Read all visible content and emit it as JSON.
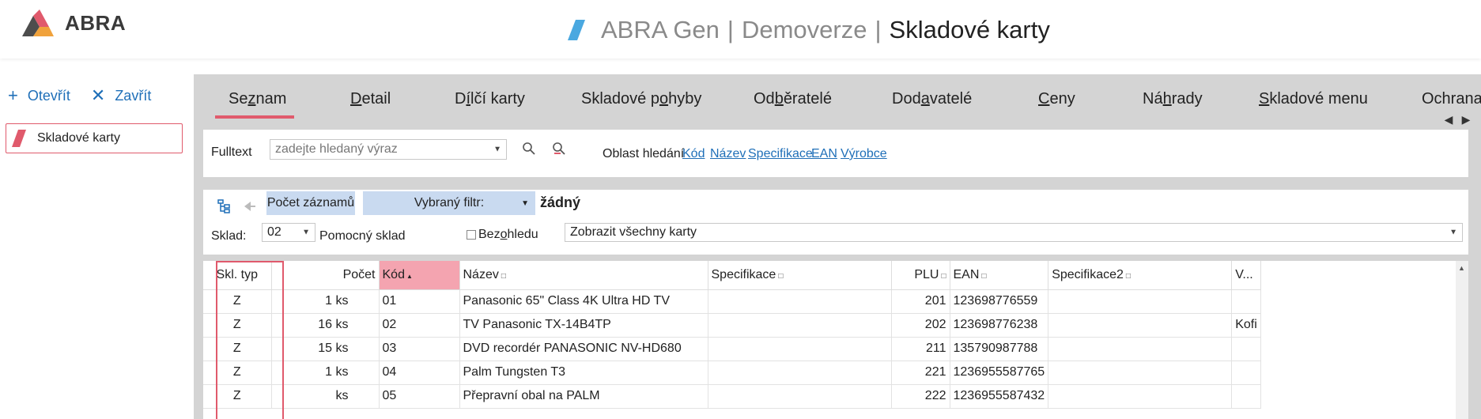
{
  "header": {
    "logo_text": "ABRA",
    "title_app": "ABRA Gen",
    "title_separator": "|",
    "title_env": "Demoverze",
    "title_page": "Skladové karty",
    "accent": "#e05a6c",
    "brand_blue": "#4aa8e0"
  },
  "left": {
    "open_label": "Otevřít",
    "close_label": "Zavřít",
    "item_label": "Skladové karty"
  },
  "tabs": [
    {
      "pre": "Se",
      "u": "z",
      "post": "nam",
      "active": true
    },
    {
      "pre": "",
      "u": "D",
      "post": "etail"
    },
    {
      "pre": "D",
      "u": "í",
      "post": "lčí karty"
    },
    {
      "pre": "Skladové p",
      "u": "o",
      "post": "hyby"
    },
    {
      "pre": "Od",
      "u": "b",
      "post": "ěratelé"
    },
    {
      "pre": "Dod",
      "u": "a",
      "post": "vatelé"
    },
    {
      "pre": "",
      "u": "C",
      "post": "eny"
    },
    {
      "pre": "Ná",
      "u": "h",
      "post": "rady"
    },
    {
      "pre": "",
      "u": "S",
      "post": "kladové menu"
    },
    {
      "pre": "Ochrana",
      "u": "",
      "post": ""
    }
  ],
  "search": {
    "fulltext_label": "Fulltext",
    "placeholder": "zadejte hledaný výraz",
    "oblast_label": "Oblast hledání",
    "oblast_links": [
      "Kód",
      "Název",
      "Specifikace",
      "EAN",
      "Výrobce"
    ]
  },
  "filter": {
    "count_button": "Počet záznamů",
    "selected_filter_label": "Vybraný filtr:",
    "selected_filter_value": "žádný",
    "sklad_label": "Sklad:",
    "sklad_value": "02",
    "sklad_name": "Pomocný sklad",
    "bez_ohledu_pre": "Bez ",
    "bez_ohledu_u": "o",
    "bez_ohledu_post": "hledu",
    "show_cards_value": "Zobrazit všechny karty"
  },
  "grid": {
    "columns": [
      "Skl. typ",
      "Počet",
      "Kód",
      "Název",
      "Specifikace",
      "PLU",
      "EAN",
      "Specifikace2",
      "V..."
    ],
    "rows": [
      [
        "Z",
        "1 ks",
        "01",
        "Panasonic 65\" Class 4K Ultra HD TV",
        "",
        "201",
        "123698776559",
        "",
        ""
      ],
      [
        "Z",
        "16 ks",
        "02",
        "TV Panasonic TX-14B4TP",
        "",
        "202",
        "123698776238",
        "",
        "Kofi"
      ],
      [
        "Z",
        "15 ks",
        "03",
        "DVD recordér PANASONIC NV-HD680",
        "",
        "211",
        "135790987788",
        "",
        ""
      ],
      [
        "Z",
        "1 ks",
        "04",
        "Palm Tungsten T3",
        "",
        "221",
        "1236955587765",
        "",
        ""
      ],
      [
        "Z",
        "ks",
        "05",
        "Přepravní obal na PALM",
        "",
        "222",
        "1236955587432",
        "",
        ""
      ]
    ]
  }
}
